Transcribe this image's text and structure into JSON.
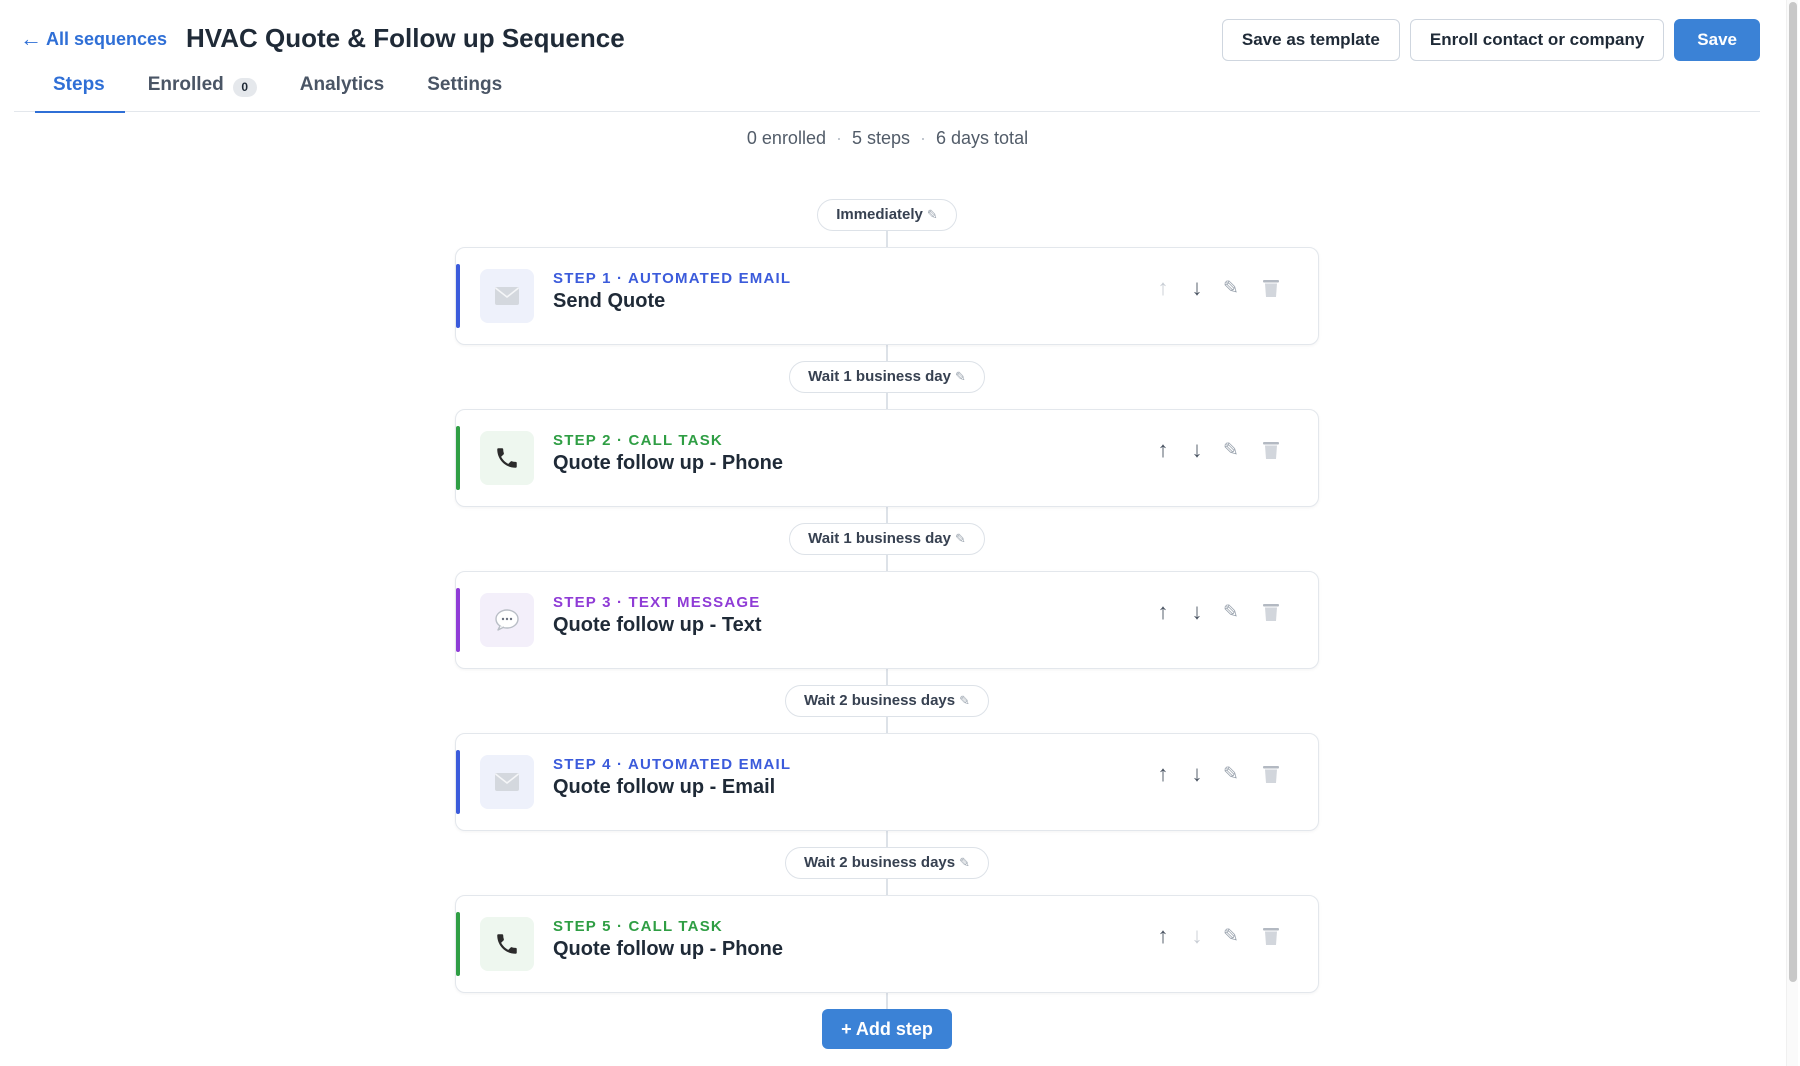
{
  "header": {
    "back_label": "All sequences",
    "title": "HVAC Quote & Follow up Sequence",
    "save_template_label": "Save as template",
    "enroll_label": "Enroll contact or company",
    "save_label": "Save"
  },
  "tabs": [
    {
      "label": "Steps",
      "active": true
    },
    {
      "label": "Enrolled",
      "badge": "0"
    },
    {
      "label": "Analytics"
    },
    {
      "label": "Settings"
    }
  ],
  "summary": {
    "enrolled": "0 enrolled",
    "steps": "5 steps",
    "duration": "6 days total"
  },
  "timeline": [
    {
      "wait": "Immediately",
      "meta": "STEP 1 · AUTOMATED EMAIL",
      "name": "Send Quote",
      "type": "email"
    },
    {
      "wait": "Wait 1 business day",
      "meta": "STEP 2 · CALL TASK",
      "name": "Quote follow up - Phone",
      "type": "call"
    },
    {
      "wait": "Wait 1 business day",
      "meta": "STEP 3 · TEXT MESSAGE",
      "name": "Quote follow up - Text",
      "type": "text"
    },
    {
      "wait": "Wait 2 business days",
      "meta": "STEP 4 · AUTOMATED EMAIL",
      "name": "Quote follow up - Email",
      "type": "email"
    },
    {
      "wait": "Wait 2 business days",
      "meta": "STEP 5 · CALL TASK",
      "name": "Quote follow up - Phone",
      "type": "call"
    }
  ],
  "add_step_label": "+ Add step",
  "icons": {
    "back": "arrow-left-icon",
    "edit": "pencil-icon",
    "move_up": "arrow-up-icon",
    "move_down": "arrow-down-icon",
    "delete": "trash-icon",
    "email": "envelope-icon",
    "call": "phone-icon",
    "text": "chat-bubble-icon"
  },
  "colors": {
    "accent": "#2f6fd6",
    "primary_button": "#3b82d6",
    "email": "#3b5bdb",
    "call": "#2f9e44",
    "text": "#8f3bd6",
    "email_icon_bg": "#eef1fb",
    "call_icon_bg": "#eef7ef",
    "text_icon_bg": "#f3effa"
  }
}
